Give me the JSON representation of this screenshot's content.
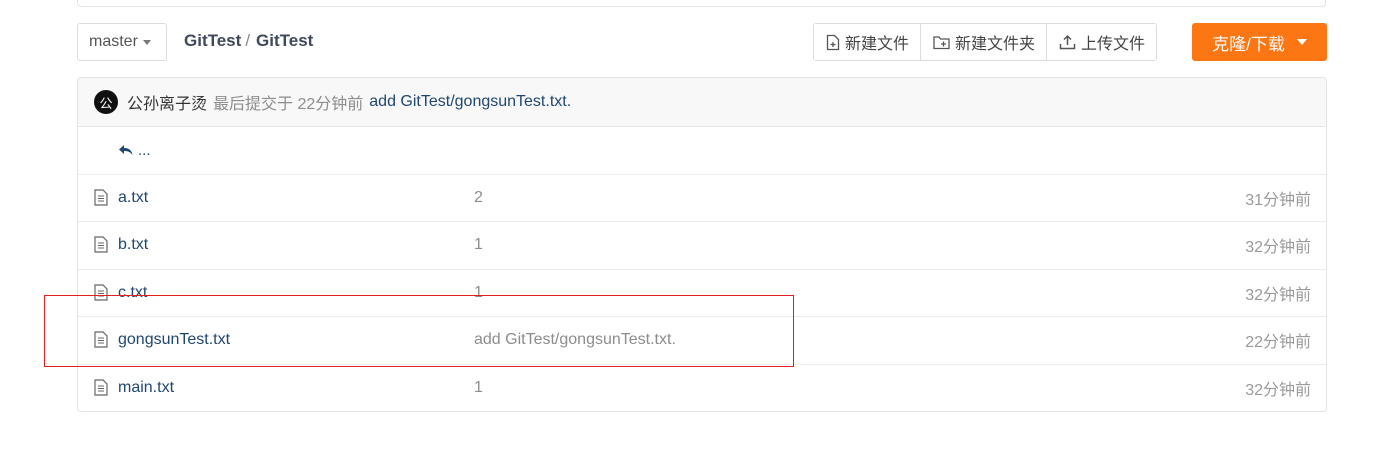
{
  "branch": {
    "label": "master"
  },
  "breadcrumb": {
    "owner": "GitTest",
    "separator": "/",
    "repo": "GitTest"
  },
  "toolbar": {
    "new_file": "新建文件",
    "new_folder": "新建文件夹",
    "upload": "上传文件",
    "clone": "克隆/下载"
  },
  "commit": {
    "avatar_text": "公",
    "author": "公孙离子烫",
    "meta": "最后提交于 22分钟前",
    "message": "add GitTest/gongsunTest.txt."
  },
  "parent_dir": {
    "label": "..."
  },
  "files": [
    {
      "name": "a.txt",
      "message": "2",
      "time": "31分钟前"
    },
    {
      "name": "b.txt",
      "message": "1",
      "time": "32分钟前"
    },
    {
      "name": "c.txt",
      "message": "1",
      "time": "32分钟前"
    },
    {
      "name": "gongsunTest.txt",
      "message": "add GitTest/gongsunTest.txt.",
      "time": "22分钟前"
    },
    {
      "name": "main.txt",
      "message": "1",
      "time": "32分钟前"
    }
  ],
  "colors": {
    "accent": "#fc7614",
    "link": "#21476f",
    "highlight": "#e02020"
  }
}
